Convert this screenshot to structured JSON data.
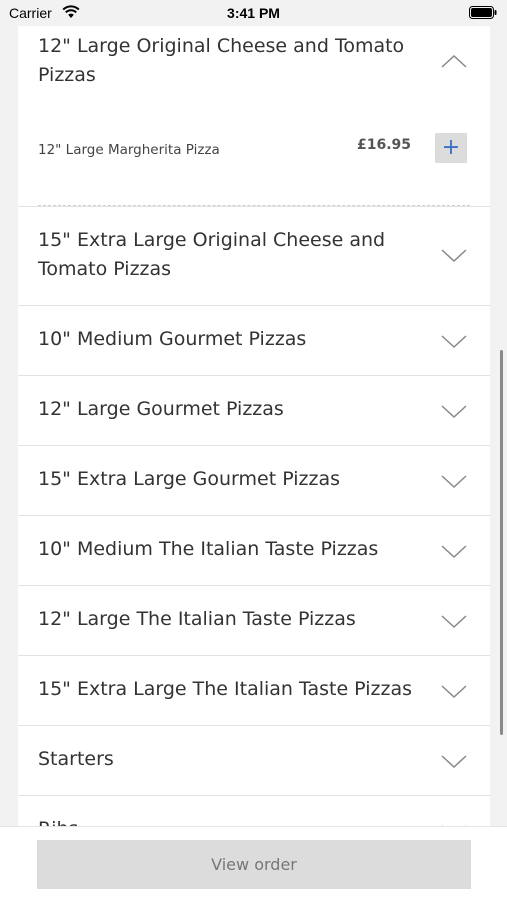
{
  "status_bar": {
    "carrier": "Carrier",
    "time": "3:41 PM"
  },
  "expanded_category": {
    "title": "12\" Large Original Cheese and Tomato Pizzas",
    "items": [
      {
        "name": "12\" Large Margherita Pizza",
        "price": "£16.95",
        "add_label": "+"
      }
    ]
  },
  "categories": [
    {
      "title": "15\" Extra Large Original Cheese and Tomato Pizzas"
    },
    {
      "title": "10\" Medium Gourmet Pizzas"
    },
    {
      "title": "12\" Large Gourmet Pizzas"
    },
    {
      "title": "15\" Extra Large Gourmet Pizzas"
    },
    {
      "title": "10\" Medium The Italian Taste Pizzas"
    },
    {
      "title": "12\" Large The Italian Taste Pizzas"
    },
    {
      "title": "15\" Extra Large The Italian Taste Pizzas"
    },
    {
      "title": "Starters"
    },
    {
      "title": "Ribs"
    }
  ],
  "footer": {
    "view_order_label": "View order"
  }
}
